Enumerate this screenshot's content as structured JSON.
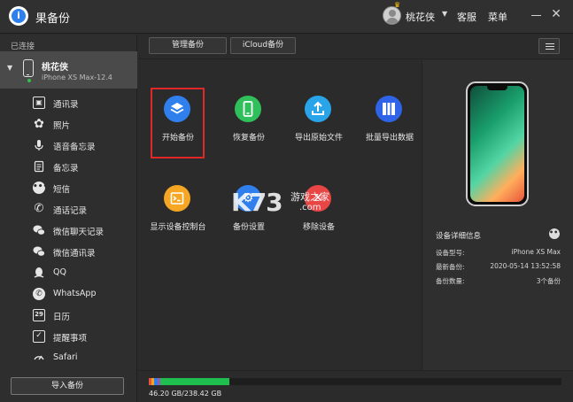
{
  "titlebar": {
    "app_title": "果备份",
    "username": "桃花侠",
    "customer_service": "客服",
    "menu": "菜单"
  },
  "sidebar": {
    "connected_label": "已连接",
    "device": {
      "name": "桃花侠",
      "model": "iPhone XS Max-12.4"
    },
    "items": [
      {
        "label": "通讯录",
        "icon": "contacts-icon"
      },
      {
        "label": "照片",
        "icon": "photos-icon"
      },
      {
        "label": "语音备忘录",
        "icon": "microphone-icon"
      },
      {
        "label": "备忘录",
        "icon": "notes-icon"
      },
      {
        "label": "短信",
        "icon": "message-icon"
      },
      {
        "label": "通话记录",
        "icon": "phone-call-icon"
      },
      {
        "label": "微信聊天记录",
        "icon": "wechat-icon"
      },
      {
        "label": "微信通讯录",
        "icon": "wechat-contacts-icon"
      },
      {
        "label": "QQ",
        "icon": "qq-icon"
      },
      {
        "label": "WhatsApp",
        "icon": "whatsapp-icon"
      },
      {
        "label": "日历",
        "icon": "calendar-icon"
      },
      {
        "label": "提醒事项",
        "icon": "reminder-icon"
      },
      {
        "label": "Safari",
        "icon": "safari-icon"
      }
    ],
    "import_button": "导入备份"
  },
  "toolbar": {
    "tabs": [
      "管理备份",
      "iCloud备份"
    ]
  },
  "functions": [
    {
      "label": "开始备份",
      "color": "#2f80ed",
      "icon": "layers-icon"
    },
    {
      "label": "恢复备份",
      "color": "#2fbf5b",
      "icon": "phone-restore-icon"
    },
    {
      "label": "导出原始文件",
      "color": "#2aa4e8",
      "icon": "upload-icon"
    },
    {
      "label": "批量导出数据",
      "color": "#2f63e8",
      "icon": "batch-export-icon"
    },
    {
      "label": "显示设备控制台",
      "color": "#f5a623",
      "icon": "console-icon"
    },
    {
      "label": "备份设置",
      "color": "#2f80ed",
      "icon": "settings-icon"
    },
    {
      "label": "移除设备",
      "color": "#e84545",
      "icon": "remove-icon"
    }
  ],
  "watermark": {
    "brand": "K73",
    "site": "游戏之家",
    "domain": ".com"
  },
  "device_details": {
    "title": "设备详细信息",
    "rows": [
      {
        "key": "设备型号:",
        "value": "iPhone XS Max"
      },
      {
        "key": "最新备份:",
        "value": "2020-05-14 13:52:58"
      },
      {
        "key": "备份数量:",
        "value": "3个备份"
      }
    ]
  },
  "storage": {
    "text": "46.20 GB/238.42 GB",
    "used_fraction": 0.194,
    "segments": [
      {
        "color": "#e8553a",
        "fraction": 0.006
      },
      {
        "color": "#f5a623",
        "fraction": 0.006
      },
      {
        "color": "#2f80ed",
        "fraction": 0.008
      },
      {
        "color": "#9b59b6",
        "fraction": 0.006
      },
      {
        "color": "#1fbf4f",
        "fraction": 0.168
      }
    ]
  }
}
